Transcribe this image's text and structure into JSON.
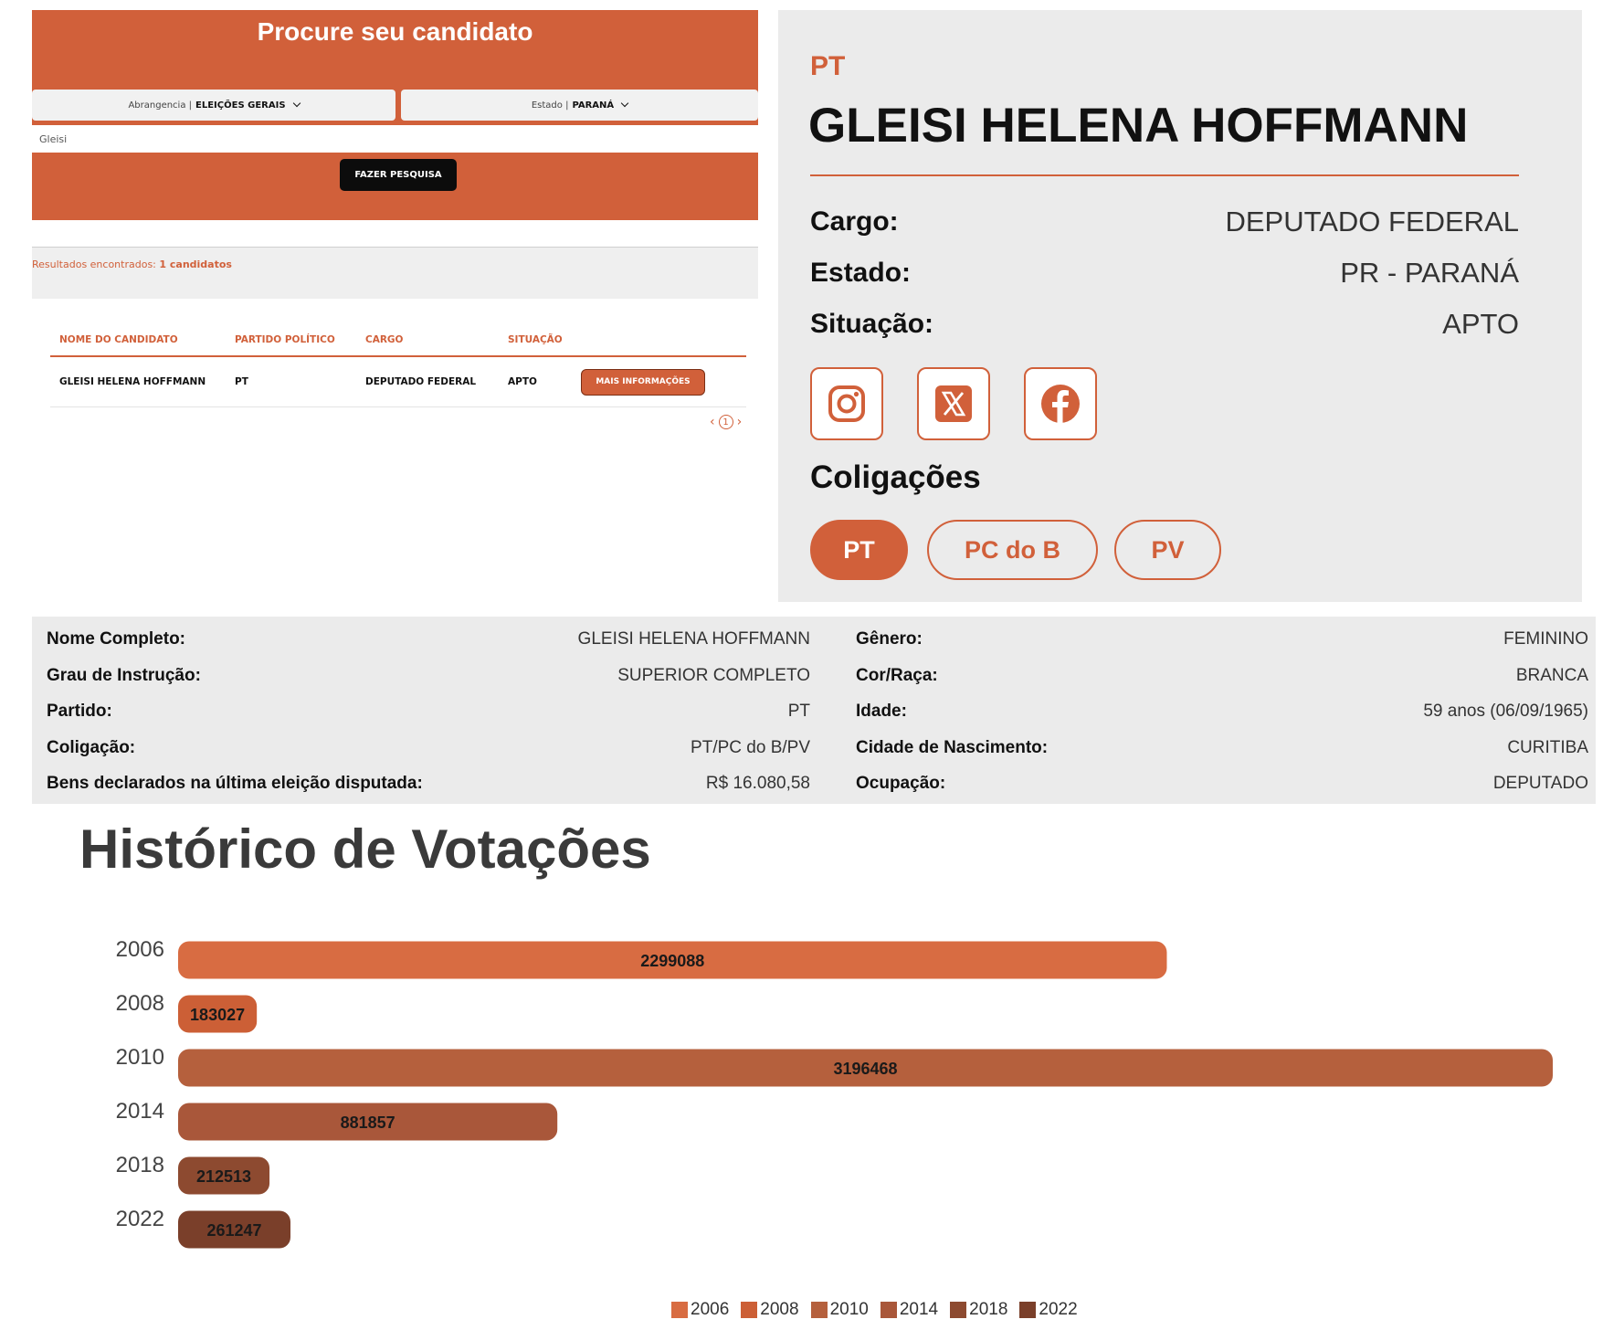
{
  "search": {
    "title": "Procure seu candidato",
    "abrangencia_label": "Abrangencia |",
    "abrangencia_value": "ELEIÇÕES GERAIS",
    "estado_label": "Estado |",
    "estado_value": "PARANÁ",
    "query_value": "Gleisi",
    "button_label": "FAZER PESQUISA"
  },
  "results": {
    "label": "Resultados encontrados:",
    "count": "1 candidatos",
    "columns": [
      "NOME DO CANDIDATO",
      "PARTIDO POLÍTICO",
      "CARGO",
      "SITUAÇÃO"
    ],
    "rows": [
      {
        "nome": "GLEISI HELENA HOFFMANN",
        "partido": "PT",
        "cargo": "DEPUTADO FEDERAL",
        "situacao": "APTO",
        "button": "MAIS INFORMAÇÕES"
      }
    ],
    "pagination": {
      "prev": "‹",
      "page": "1",
      "next": "›"
    }
  },
  "card": {
    "party": "PT",
    "name": "GLEISI HELENA HOFFMANN",
    "fields": [
      {
        "label": "Cargo:",
        "value": "DEPUTADO FEDERAL"
      },
      {
        "label": "Estado:",
        "value": "PR - PARANÁ"
      },
      {
        "label": "Situação:",
        "value": "APTO"
      }
    ],
    "social": [
      "instagram-icon",
      "x-twitter-icon",
      "facebook-icon"
    ],
    "coligacoes_title": "Coligações",
    "coligacoes": [
      "PT",
      "PC do B",
      "PV"
    ]
  },
  "details": {
    "left": [
      {
        "label": "Nome Completo:",
        "value": "GLEISI HELENA HOFFMANN"
      },
      {
        "label": "Grau de Instrução:",
        "value": "SUPERIOR COMPLETO"
      },
      {
        "label": "Partido:",
        "value": "PT"
      },
      {
        "label": "Coligação:",
        "value": "PT/PC do B/PV"
      },
      {
        "label": "Bens declarados na última eleição disputada:",
        "value": "R$ 16.080,58"
      }
    ],
    "right": [
      {
        "label": "Gênero:",
        "value": "FEMININO"
      },
      {
        "label": "Cor/Raça:",
        "value": "BRANCA"
      },
      {
        "label": "Idade:",
        "value": "59 anos (06/09/1965)"
      },
      {
        "label": "Cidade de Nascimento:",
        "value": "CURITIBA"
      },
      {
        "label": "Ocupação:",
        "value": "DEPUTADO"
      }
    ]
  },
  "history_title": "Histórico de Votações",
  "colors": {
    "accent": "#d1603a",
    "bars": [
      "#d86c42",
      "#cc5f36",
      "#b5603d",
      "#a9573a",
      "#8d4a30",
      "#7a3f2a"
    ]
  },
  "chart_data": {
    "type": "bar",
    "orientation": "horizontal",
    "title": "Histórico de Votações",
    "categories": [
      "2006",
      "2008",
      "2010",
      "2014",
      "2018",
      "2022"
    ],
    "values": [
      2299088,
      183027,
      3196468,
      881857,
      212513,
      261247
    ],
    "xlim": [
      0,
      3196468
    ],
    "grid": false,
    "legend_position": "bottom-center",
    "legend": [
      "2006",
      "2008",
      "2010",
      "2014",
      "2018",
      "2022"
    ]
  }
}
